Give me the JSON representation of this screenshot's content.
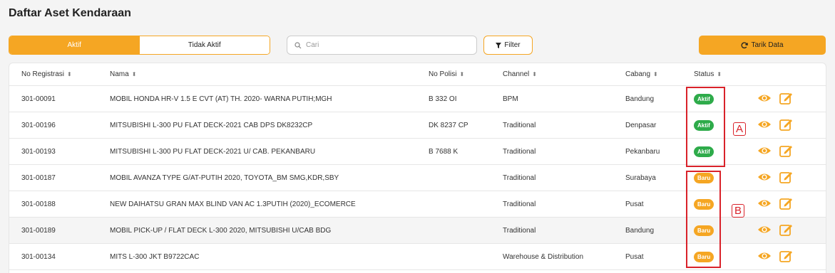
{
  "page": {
    "title": "Daftar Aset Kendaraan"
  },
  "tabs": {
    "active_label": "Aktif",
    "inactive_label": "Tidak Aktif"
  },
  "search": {
    "placeholder": "Cari",
    "value": ""
  },
  "filter": {
    "label": "Filter"
  },
  "tarik": {
    "label": "Tarik Data"
  },
  "table": {
    "headers": {
      "no_registrasi": "No Registrasi",
      "nama": "Nama",
      "no_polisi": "No Polisi",
      "channel": "Channel",
      "cabang": "Cabang",
      "status": "Status"
    },
    "rows": [
      {
        "no": "301-00091",
        "nama": "MOBIL HONDA HR-V 1.5 E CVT (AT) TH. 2020- WARNA PUTIH;MGH",
        "polisi": "B 332 OI",
        "channel": "BPM",
        "cabang": "Bandung",
        "status": "Aktif",
        "status_type": "aktif"
      },
      {
        "no": "301-00196",
        "nama": "MITSUBISHI L-300 PU FLAT DECK-2021 CAB DPS DK8232CP",
        "polisi": "DK 8237 CP",
        "channel": "Traditional",
        "cabang": "Denpasar",
        "status": "Aktif",
        "status_type": "aktif"
      },
      {
        "no": "301-00193",
        "nama": "MITSUBISHI L-300 PU FLAT DECK-2021 U/ CAB. PEKANBARU",
        "polisi": "B 7688 K",
        "channel": "Traditional",
        "cabang": "Pekanbaru",
        "status": "Aktif",
        "status_type": "aktif"
      },
      {
        "no": "301-00187",
        "nama": "MOBIL AVANZA TYPE G/AT-PUTIH 2020, TOYOTA_BM SMG,KDR,SBY",
        "polisi": "",
        "channel": "Traditional",
        "cabang": "Surabaya",
        "status": "Baru",
        "status_type": "baru"
      },
      {
        "no": "301-00188",
        "nama": "NEW DAIHATSU GRAN MAX BLIND VAN AC 1.3PUTIH (2020)_ECOMERCE",
        "polisi": "",
        "channel": "Traditional",
        "cabang": "Pusat",
        "status": "Baru",
        "status_type": "baru"
      },
      {
        "no": "301-00189",
        "nama": "MOBIL PICK-UP / FLAT DECK L-300 2020, MITSUBISHI U/CAB BDG",
        "polisi": "",
        "channel": "Traditional",
        "cabang": "Bandung",
        "status": "Baru",
        "status_type": "baru"
      },
      {
        "no": "301-00134",
        "nama": "MITS L-300 JKT B9722CAC",
        "polisi": "",
        "channel": "Warehouse & Distribution",
        "cabang": "Pusat",
        "status": "Baru",
        "status_type": "baru"
      }
    ]
  },
  "annotations": {
    "a": "A",
    "b": "B"
  },
  "colors": {
    "accent": "#f5a623",
    "aktif": "#2eab4a",
    "baru": "#f5a623",
    "annotation": "#d9222a"
  }
}
